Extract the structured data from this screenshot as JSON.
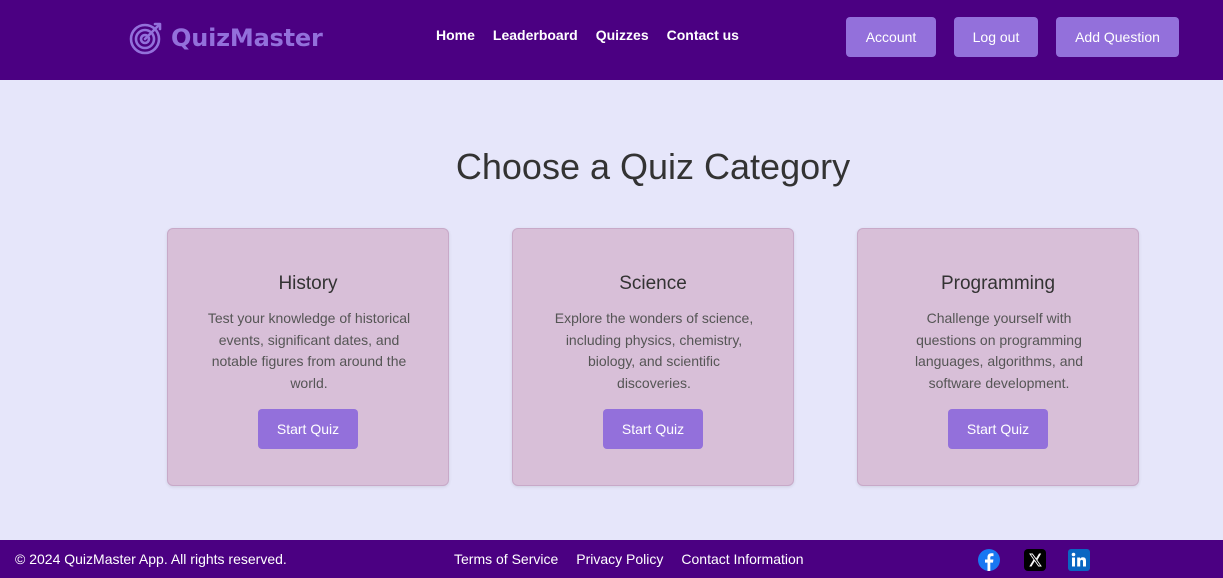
{
  "brand": {
    "name": "QuizMaster",
    "icon": "target-arrow-icon",
    "color": "#9370db"
  },
  "nav": {
    "links": [
      "Home",
      "Leaderboard",
      "Quizzes",
      "Contact us"
    ]
  },
  "header_buttons": {
    "account": "Account",
    "logout": "Log out",
    "add_question": "Add Question"
  },
  "main": {
    "title": "Choose a Quiz Category",
    "categories": [
      {
        "title": "History",
        "description": "Test your knowledge of historical events, significant dates, and notable figures from around the world.",
        "button": "Start Quiz"
      },
      {
        "title": "Science",
        "description": "Explore the wonders of science, including physics, chemistry, biology, and scientific discoveries.",
        "button": "Start Quiz"
      },
      {
        "title": "Programming",
        "description": "Challenge yourself with questions on programming languages, algorithms, and software development.",
        "button": "Start Quiz"
      }
    ]
  },
  "footer": {
    "copyright": "© 2024 QuizMaster App. All rights reserved.",
    "links": [
      "Terms of Service",
      "Privacy Policy",
      "Contact Information"
    ],
    "social": [
      "facebook-icon",
      "x-twitter-icon",
      "linkedin-icon"
    ]
  },
  "colors": {
    "header_bg": "#4b0082",
    "accent": "#9370db",
    "page_bg": "#e6e6fa",
    "card_bg": "#d8bfd8",
    "facebook": "#1877f2",
    "linkedin": "#0a66c2"
  }
}
